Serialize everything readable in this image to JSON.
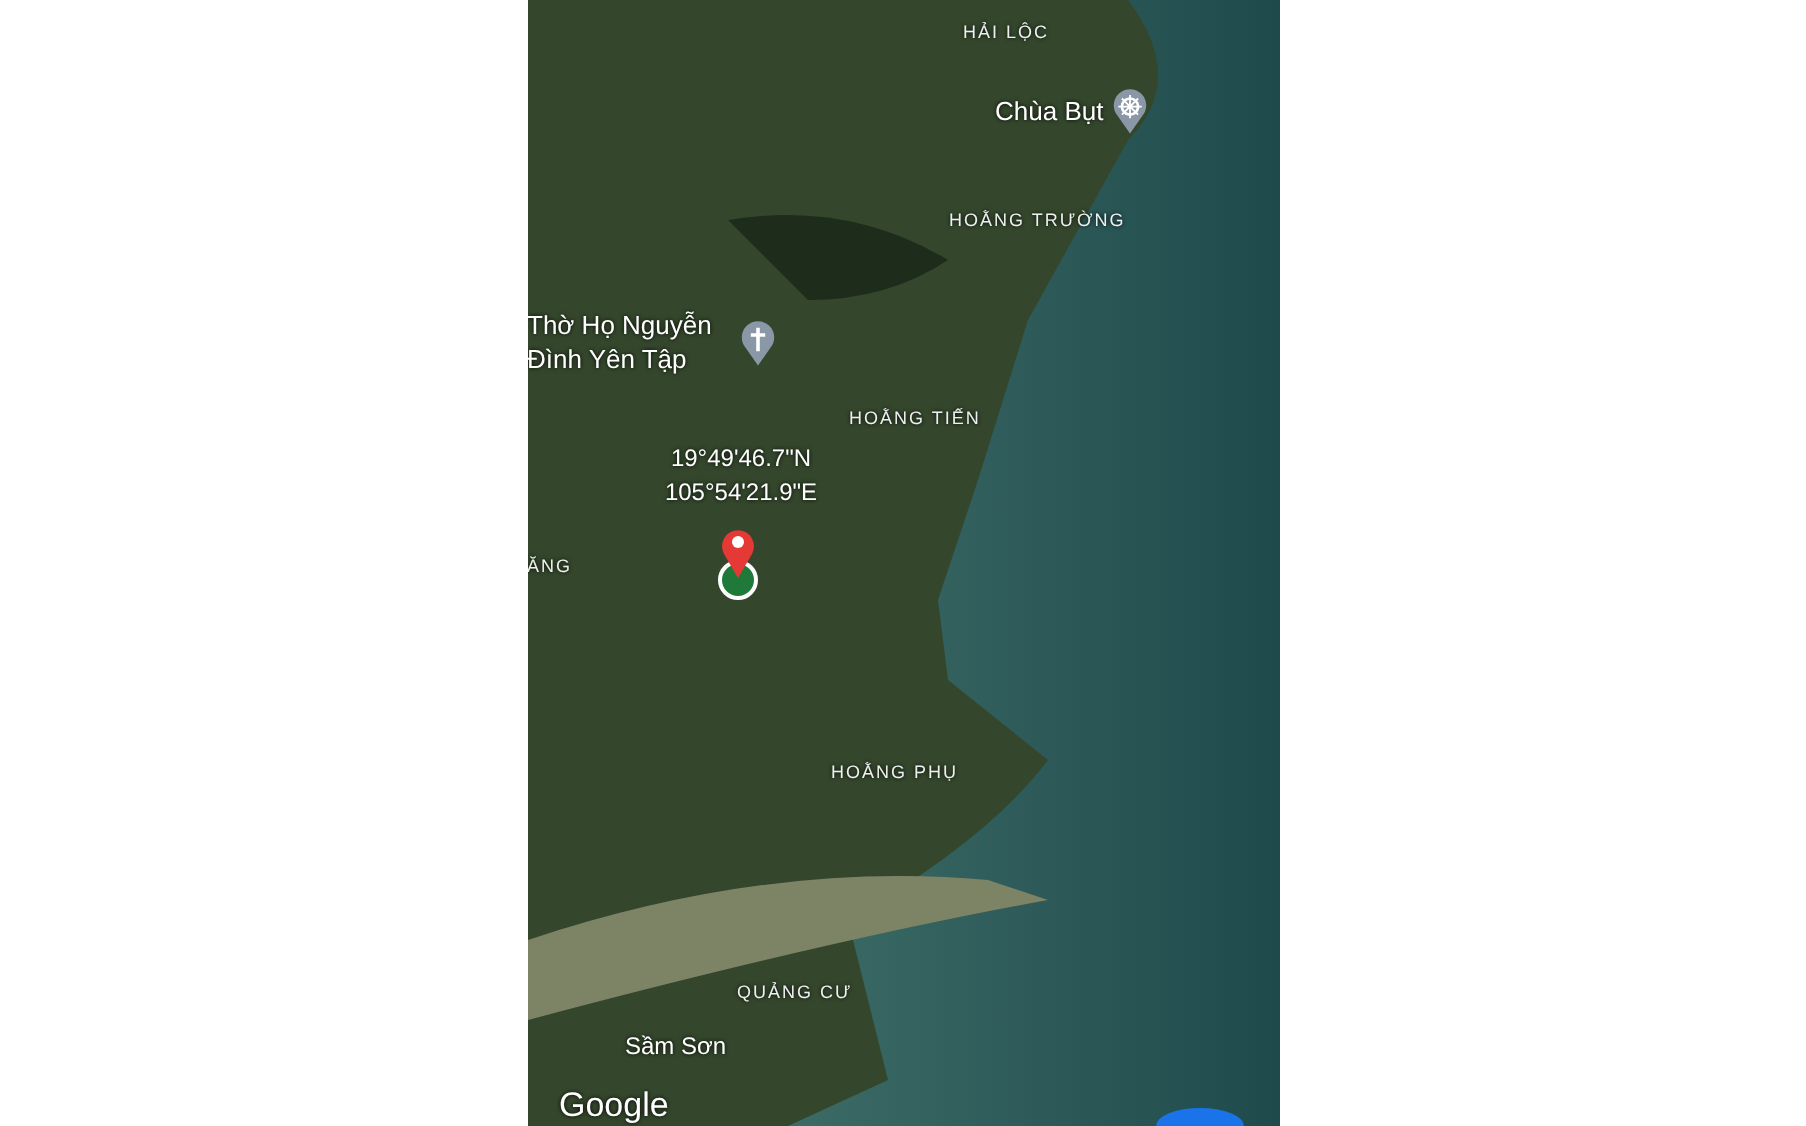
{
  "map": {
    "labels": [
      {
        "kind": "area",
        "text": "HẢI LỘC"
      },
      {
        "kind": "pagoda",
        "text": "Chùa Bụt"
      },
      {
        "kind": "area",
        "text": "HOẰNG TRƯỜNG"
      },
      {
        "kind": "shrine",
        "text": "Thờ Họ Nguyễn Đình Yên Tập"
      },
      {
        "kind": "area",
        "text": "HOẰNG TIẾN"
      },
      {
        "kind": "coords",
        "text": "19°49'46.7\"N 105°54'21.9\"E"
      },
      {
        "kind": "area",
        "text": "ĂNG"
      },
      {
        "kind": "area",
        "text": "HOẰNG PHỤ"
      },
      {
        "kind": "area",
        "text": "QUẢNG CƯ"
      },
      {
        "kind": "city",
        "text": "Sầm Sơn"
      }
    ],
    "attribution": "Google"
  }
}
